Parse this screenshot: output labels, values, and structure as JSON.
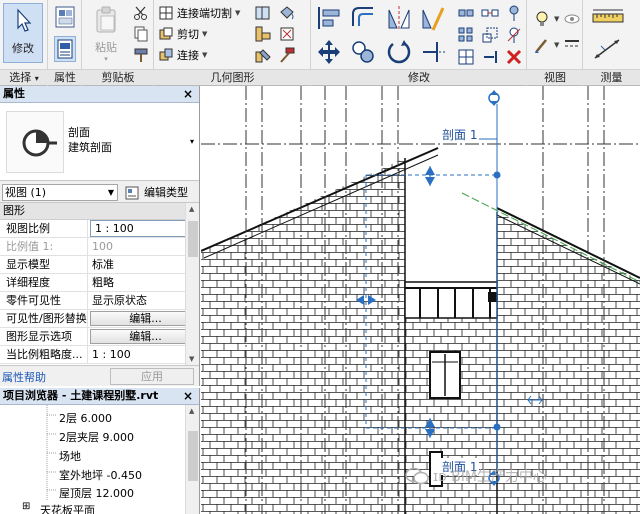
{
  "ribbon": {
    "select": {
      "modify_label": "修改",
      "menu_label": "选择",
      "menu_caret": "▾"
    },
    "properties_panel_label": "属性",
    "clipboard": {
      "title": "剪贴板",
      "paste_label": "粘贴"
    },
    "geometry": {
      "title": "几何图形",
      "join_cut_label": "连接端切割",
      "cut_label": "剪切",
      "join_label": "连接"
    },
    "modify_panel_title": "修改",
    "view_panel_title": "视图",
    "measure_panel_title": "测量"
  },
  "properties": {
    "title": "属性",
    "close": "×",
    "type_name_line1": "剖面",
    "type_name_line2": "建筑剖面",
    "type_dropdown": "▾",
    "view_selector": "视图 (1)",
    "edit_type_label": "编辑类型",
    "group_header": "图形",
    "rows": [
      {
        "key": "视图比例",
        "value": "1 : 100"
      },
      {
        "key": "比例值 1:",
        "value": "100"
      },
      {
        "key": "显示模型",
        "value": "标准"
      },
      {
        "key": "详细程度",
        "value": "粗略"
      },
      {
        "key": "零件可见性",
        "value": "显示原状态"
      },
      {
        "key": "可见性/图形替换",
        "value": "编辑..."
      },
      {
        "key": "图形显示选项",
        "value": "编辑..."
      },
      {
        "key": "当比例粗略度...",
        "value": "1 : 100"
      }
    ],
    "help_link": "属性帮助",
    "apply_label": "应用"
  },
  "browser": {
    "title": "项目浏览器 - 土建课程别墅.rvt",
    "close": "×",
    "items": [
      "2层 6.000",
      "2层夹层 9.000",
      "场地",
      "室外地坪 -0.450",
      "屋顶层 12.000",
      "天花板平面"
    ],
    "expander": "⊞"
  },
  "canvas": {
    "section_label_top": "剖面 1",
    "section_label_bottom": "剖面 1"
  },
  "watermark": "ɪᴅ BIM生产力中心",
  "colors": {
    "ribbon_bg": "#f3f3f3",
    "palette_header": "#d9e4f2",
    "link_blue": "#1a56b8",
    "section_line_blue": "#2a6fc0",
    "annotation_green": "#3aa043"
  }
}
